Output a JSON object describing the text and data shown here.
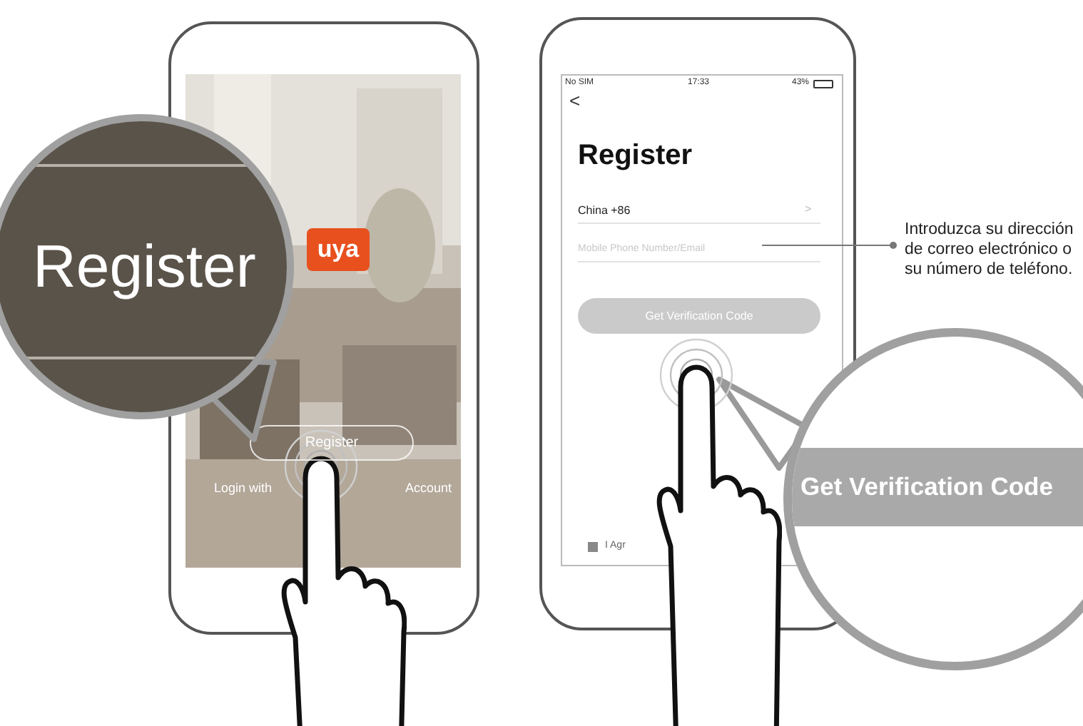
{
  "left_phone": {
    "logo": "uya",
    "register_button": "Register",
    "login_link": [
      "Login with",
      "Account"
    ]
  },
  "left_magnifier": {
    "label": "Register"
  },
  "right_phone": {
    "status_bar": {
      "carrier": "No SIM",
      "time": "17:33",
      "battery": "43%"
    },
    "back": "<",
    "title": "Register",
    "country": {
      "value": "China +86",
      "chevron": ">"
    },
    "input": {
      "placeholder": "Mobile Phone Number/Email"
    },
    "button": {
      "label": "Get Verification Code",
      "disabled": true
    },
    "agreement": {
      "label": "I Agr",
      "checked": true
    }
  },
  "callout": "Introduzca su dirección de correo electrónico o su número de teléfono.",
  "right_magnifier": {
    "label": "Get Verification Code"
  }
}
